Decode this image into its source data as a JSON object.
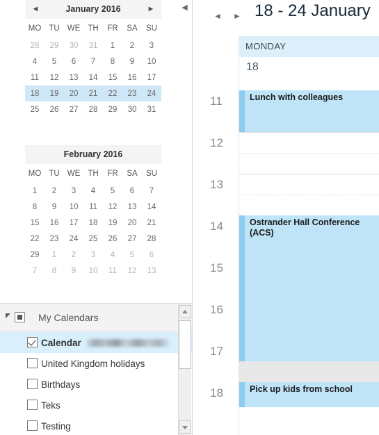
{
  "left_pane": {
    "collapse_icon": "chevron-left-icon",
    "mini_calendars": [
      {
        "title": "January 2016",
        "prev_label": "◄",
        "next_label": "►",
        "weekday_headers": [
          "MO",
          "TU",
          "WE",
          "TH",
          "FR",
          "SA",
          "SU"
        ],
        "weeks": [
          {
            "selected": false,
            "days": [
              {
                "n": "28",
                "out": true
              },
              {
                "n": "29",
                "out": true
              },
              {
                "n": "30",
                "out": true
              },
              {
                "n": "31",
                "out": true
              },
              {
                "n": "1",
                "out": false
              },
              {
                "n": "2",
                "out": false
              },
              {
                "n": "3",
                "out": false
              }
            ]
          },
          {
            "selected": false,
            "days": [
              {
                "n": "4",
                "out": false
              },
              {
                "n": "5",
                "out": false
              },
              {
                "n": "6",
                "out": false
              },
              {
                "n": "7",
                "out": false
              },
              {
                "n": "8",
                "out": false
              },
              {
                "n": "9",
                "out": false
              },
              {
                "n": "10",
                "out": false
              }
            ]
          },
          {
            "selected": false,
            "days": [
              {
                "n": "11",
                "out": false
              },
              {
                "n": "12",
                "out": false
              },
              {
                "n": "13",
                "out": false
              },
              {
                "n": "14",
                "out": false
              },
              {
                "n": "15",
                "out": false
              },
              {
                "n": "16",
                "out": false
              },
              {
                "n": "17",
                "out": false
              }
            ]
          },
          {
            "selected": true,
            "days": [
              {
                "n": "18",
                "out": false
              },
              {
                "n": "19",
                "out": false
              },
              {
                "n": "20",
                "out": false
              },
              {
                "n": "21",
                "out": false
              },
              {
                "n": "22",
                "out": false
              },
              {
                "n": "23",
                "out": false
              },
              {
                "n": "24",
                "out": false
              }
            ]
          },
          {
            "selected": false,
            "days": [
              {
                "n": "25",
                "out": false
              },
              {
                "n": "26",
                "out": false
              },
              {
                "n": "27",
                "out": false
              },
              {
                "n": "28",
                "out": false
              },
              {
                "n": "29",
                "out": false
              },
              {
                "n": "30",
                "out": false
              },
              {
                "n": "31",
                "out": false
              }
            ]
          }
        ]
      },
      {
        "title": "February 2016",
        "prev_label": "",
        "next_label": "",
        "weekday_headers": [
          "MO",
          "TU",
          "WE",
          "TH",
          "FR",
          "SA",
          "SU"
        ],
        "weeks": [
          {
            "selected": false,
            "days": [
              {
                "n": "1",
                "out": false
              },
              {
                "n": "2",
                "out": false
              },
              {
                "n": "3",
                "out": false
              },
              {
                "n": "4",
                "out": false
              },
              {
                "n": "5",
                "out": false
              },
              {
                "n": "6",
                "out": false
              },
              {
                "n": "7",
                "out": false
              }
            ]
          },
          {
            "selected": false,
            "days": [
              {
                "n": "8",
                "out": false
              },
              {
                "n": "9",
                "out": false
              },
              {
                "n": "10",
                "out": false
              },
              {
                "n": "11",
                "out": false
              },
              {
                "n": "12",
                "out": false
              },
              {
                "n": "13",
                "out": false
              },
              {
                "n": "14",
                "out": false
              }
            ]
          },
          {
            "selected": false,
            "days": [
              {
                "n": "15",
                "out": false
              },
              {
                "n": "16",
                "out": false
              },
              {
                "n": "17",
                "out": false
              },
              {
                "n": "18",
                "out": false
              },
              {
                "n": "19",
                "out": false
              },
              {
                "n": "20",
                "out": false
              },
              {
                "n": "21",
                "out": false
              }
            ]
          },
          {
            "selected": false,
            "days": [
              {
                "n": "22",
                "out": false
              },
              {
                "n": "23",
                "out": false
              },
              {
                "n": "24",
                "out": false
              },
              {
                "n": "25",
                "out": false
              },
              {
                "n": "26",
                "out": false
              },
              {
                "n": "27",
                "out": false
              },
              {
                "n": "28",
                "out": false
              }
            ]
          },
          {
            "selected": false,
            "days": [
              {
                "n": "29",
                "out": false
              },
              {
                "n": "1",
                "out": true
              },
              {
                "n": "2",
                "out": true
              },
              {
                "n": "3",
                "out": true
              },
              {
                "n": "4",
                "out": true
              },
              {
                "n": "5",
                "out": true
              },
              {
                "n": "6",
                "out": true
              }
            ]
          },
          {
            "selected": false,
            "days": [
              {
                "n": "7",
                "out": true
              },
              {
                "n": "8",
                "out": true
              },
              {
                "n": "9",
                "out": true
              },
              {
                "n": "10",
                "out": true
              },
              {
                "n": "11",
                "out": true
              },
              {
                "n": "12",
                "out": true
              },
              {
                "n": "13",
                "out": true
              }
            ]
          }
        ]
      }
    ],
    "calendar_list": {
      "group_label": "My Calendars",
      "group_expand_icon": "triangle-collapse-icon",
      "group_color_icon": "square-swatch-icon",
      "items": [
        {
          "name": "Calendar",
          "checked": true,
          "selected": true,
          "redacted_account": true
        },
        {
          "name": "United Kingdom holidays",
          "checked": false,
          "selected": false,
          "redacted_account": false
        },
        {
          "name": "Birthdays",
          "checked": false,
          "selected": false,
          "redacted_account": false
        },
        {
          "name": "Teks",
          "checked": false,
          "selected": false,
          "redacted_account": false
        },
        {
          "name": "Testing",
          "checked": false,
          "selected": false,
          "redacted_account": false
        }
      ],
      "scrollbar": {
        "up_icon": "scroll-up-arrow-icon",
        "down_icon": "scroll-down-arrow-icon"
      }
    }
  },
  "right_pane": {
    "week_title": "18 - 24 January",
    "prev_week_label": "◄",
    "next_week_label": "►",
    "day_column": {
      "day_name": "MONDAY",
      "day_number": "18"
    },
    "hours": [
      "11",
      "12",
      "13",
      "14",
      "15",
      "16",
      "17",
      "18"
    ],
    "events": [
      {
        "title": "Lunch with colleagues",
        "start_hour": "11",
        "end_hour": "12"
      },
      {
        "title": "Ostrander Hall Conference (ACS)",
        "start_hour": "14",
        "end_hour": "17.5"
      },
      {
        "title": "Pick up kids from school",
        "start_hour": "18",
        "end_hour": "18.6"
      }
    ]
  },
  "colors": {
    "selection_blue": "#cfe8f7",
    "day_header_blue": "#ddeffa",
    "event_fill": "#bfe4f8",
    "event_accent": "#8dcdee",
    "shade_band": "#e8e8e8"
  }
}
